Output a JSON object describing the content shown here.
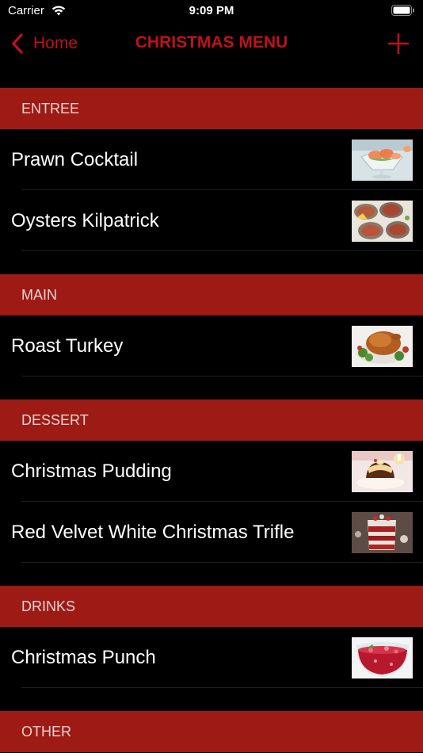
{
  "status_bar": {
    "carrier": "Carrier",
    "time": "9:09 PM"
  },
  "nav": {
    "back_label": "Home",
    "title": "CHRISTMAS MENU"
  },
  "colors": {
    "accent": "#c0121a",
    "section_background": "#9e1a14",
    "background": "#000000"
  },
  "sections": [
    {
      "title": "ENTREE",
      "items": [
        {
          "name": "Prawn Cocktail",
          "icon": "prawn-cocktail-photo"
        },
        {
          "name": "Oysters Kilpatrick",
          "icon": "oysters-photo"
        }
      ]
    },
    {
      "title": "MAIN",
      "items": [
        {
          "name": "Roast Turkey",
          "icon": "roast-turkey-photo"
        }
      ]
    },
    {
      "title": "DESSERT",
      "items": [
        {
          "name": "Christmas Pudding",
          "icon": "christmas-pudding-photo"
        },
        {
          "name": "Red Velvet White Christmas Trifle",
          "icon": "trifle-photo"
        }
      ]
    },
    {
      "title": "DRINKS",
      "items": [
        {
          "name": "Christmas Punch",
          "icon": "punch-photo"
        }
      ]
    },
    {
      "title": "OTHER",
      "items": []
    }
  ]
}
